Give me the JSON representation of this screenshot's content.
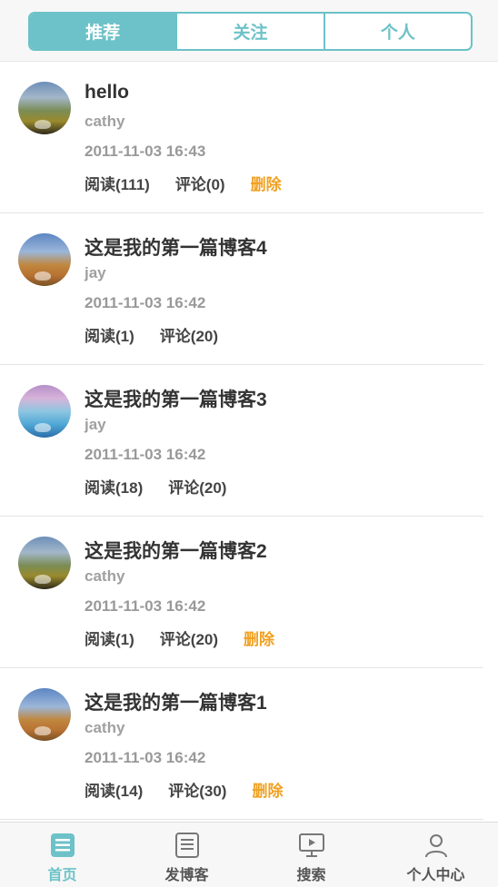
{
  "segments": [
    {
      "label": "推荐",
      "active": true
    },
    {
      "label": "关注",
      "active": false
    },
    {
      "label": "个人",
      "active": false
    }
  ],
  "posts": [
    {
      "title": "hello",
      "author": "cathy",
      "time": "2011-11-03 16:43",
      "reads": "阅读(111)",
      "comments": "评论(0)",
      "delete": "删除",
      "avatar": "mountain"
    },
    {
      "title": "这是我的第一篇博客4",
      "author": "jay",
      "time": "2011-11-03 16:42",
      "reads": "阅读(1)",
      "comments": "评论(20)",
      "delete": "",
      "avatar": "desert"
    },
    {
      "title": "这是我的第一篇博客3",
      "author": "jay",
      "time": "2011-11-03 16:42",
      "reads": "阅读(18)",
      "comments": "评论(20)",
      "delete": "",
      "avatar": "sea"
    },
    {
      "title": "这是我的第一篇博客2",
      "author": "cathy",
      "time": "2011-11-03 16:42",
      "reads": "阅读(1)",
      "comments": "评论(20)",
      "delete": "删除",
      "avatar": "mountain"
    },
    {
      "title": "这是我的第一篇博客1",
      "author": "cathy",
      "time": "2011-11-03 16:42",
      "reads": "阅读(14)",
      "comments": "评论(30)",
      "delete": "删除",
      "avatar": "desert"
    }
  ],
  "tabbar": [
    {
      "label": "首页",
      "icon": "home-list-icon",
      "active": true
    },
    {
      "label": "发博客",
      "icon": "compose-icon",
      "active": false
    },
    {
      "label": "搜索",
      "icon": "screen-play-icon",
      "active": false
    },
    {
      "label": "个人中心",
      "icon": "user-icon",
      "active": false
    }
  ],
  "colors": {
    "accent": "#6cc2c8",
    "delete": "#f0a020",
    "muted": "#999999"
  }
}
